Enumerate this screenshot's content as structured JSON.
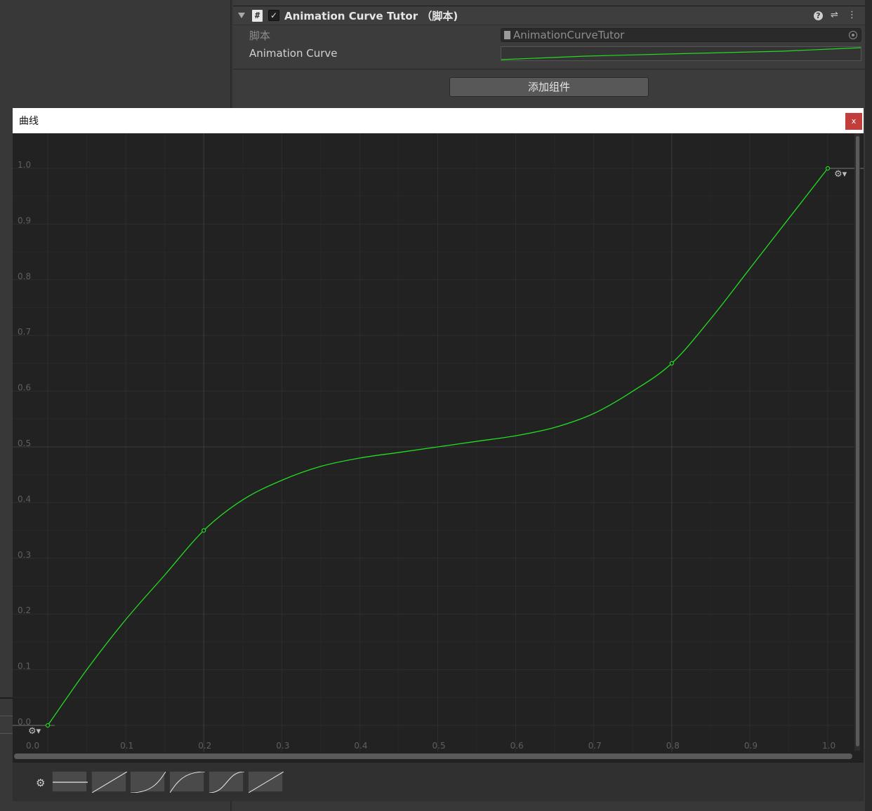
{
  "inspector": {
    "component_title": "Animation Curve Tutor （脚本)",
    "script_label": "脚本",
    "script_value": "AnimationCurveTutor",
    "curve_label": "Animation Curve",
    "add_component_label": "添加组件"
  },
  "curve_window": {
    "title": "曲线",
    "close_label": "x"
  },
  "colors": {
    "curve": "#22dd22",
    "background": "#222222",
    "close": "#c43d3d"
  },
  "chart_data": {
    "type": "line",
    "title": "",
    "xlabel": "",
    "ylabel": "",
    "xlim": [
      0.0,
      1.0
    ],
    "ylim": [
      0.0,
      1.0
    ],
    "x_ticks": [
      "0.0",
      "0.1",
      "0.2",
      "0.3",
      "0.4",
      "0.5",
      "0.6",
      "0.7",
      "0.8",
      "0.9",
      "1.0"
    ],
    "y_ticks": [
      "0.0",
      "0.1",
      "0.2",
      "0.3",
      "0.4",
      "0.5",
      "0.6",
      "0.7",
      "0.8",
      "0.9",
      "1.0"
    ],
    "grid": true,
    "keyframes": [
      {
        "x": 0.0,
        "y": 0.0
      },
      {
        "x": 0.2,
        "y": 0.35
      },
      {
        "x": 0.8,
        "y": 0.65
      },
      {
        "x": 1.0,
        "y": 1.0
      }
    ],
    "series": [
      {
        "x": [
          0.0,
          0.05,
          0.1,
          0.15,
          0.2,
          0.25,
          0.3,
          0.35,
          0.4,
          0.45,
          0.5,
          0.55,
          0.6,
          0.65,
          0.7,
          0.75,
          0.8,
          0.85,
          0.9,
          0.95,
          1.0
        ],
        "y": [
          0.0,
          0.1,
          0.19,
          0.27,
          0.35,
          0.405,
          0.44,
          0.465,
          0.48,
          0.49,
          0.5,
          0.51,
          0.52,
          0.535,
          0.56,
          0.6,
          0.65,
          0.73,
          0.82,
          0.91,
          1.0
        ]
      }
    ]
  },
  "presets": [
    "flat",
    "linear",
    "ease-in",
    "ease-out",
    "ease-in-out",
    "linear-alt"
  ]
}
